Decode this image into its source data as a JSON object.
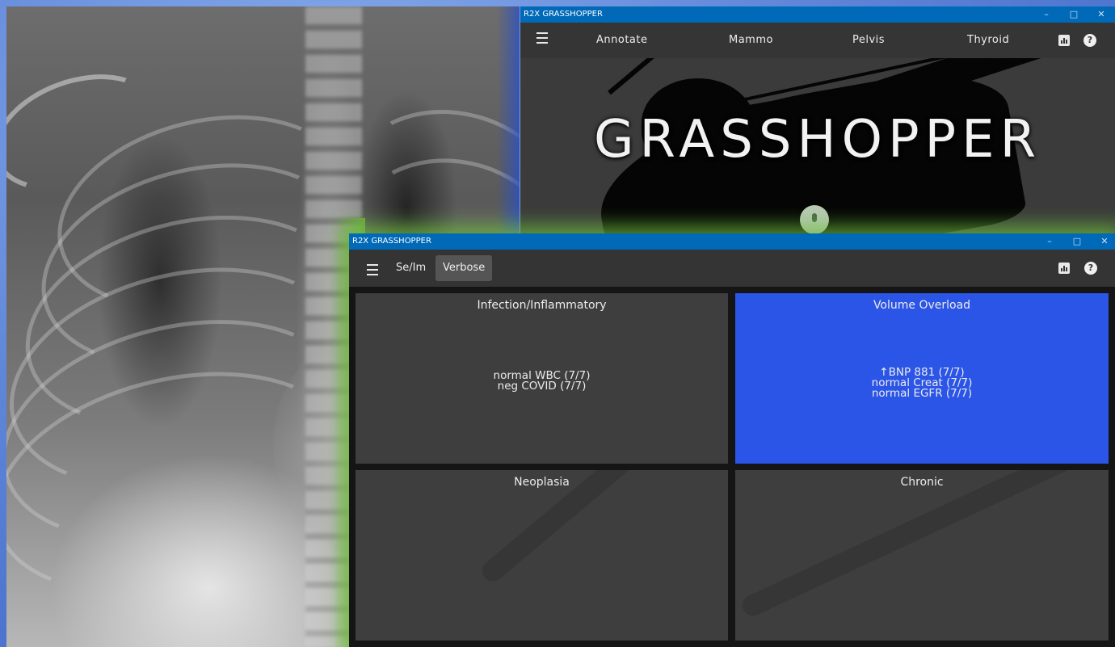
{
  "back_window": {
    "title": "R2X GRASSHOPPER",
    "controls": [
      "–",
      "□",
      "✕"
    ],
    "nav": [
      "Annotate",
      "Mammo",
      "Pelvis",
      "Thyroid"
    ],
    "icons": [
      "menu-icon",
      "chart-icon",
      "help-icon",
      "microphone-icon"
    ],
    "hero_title": "GRASSHOPPER",
    "help_glyph": "?"
  },
  "front_window": {
    "title": "R2X GRASSHOPPER",
    "controls": [
      "–",
      "□",
      "✕"
    ],
    "tabs": [
      "Se/Im",
      "Verbose"
    ],
    "active_tab": "Verbose",
    "help_glyph": "?",
    "panels": [
      {
        "title": "Infection/Inflammatory",
        "lines": [
          "normal WBC (7/7)",
          "neg COVID (7/7)"
        ],
        "highlighted": false
      },
      {
        "title": "Volume Overload",
        "lines": [
          "↑BNP 881 (7/7)",
          "normal Creat (7/7)",
          "normal EGFR (7/7)"
        ],
        "highlighted": true
      },
      {
        "title": "Neoplasia",
        "lines": [],
        "highlighted": false
      },
      {
        "title": "Chronic",
        "lines": [],
        "highlighted": false
      }
    ]
  },
  "colors": {
    "titlebar": "#0069b8",
    "highlight_panel": "#2b55e6",
    "panel": "#3e3e3e",
    "glow": "#6ebe3c"
  }
}
